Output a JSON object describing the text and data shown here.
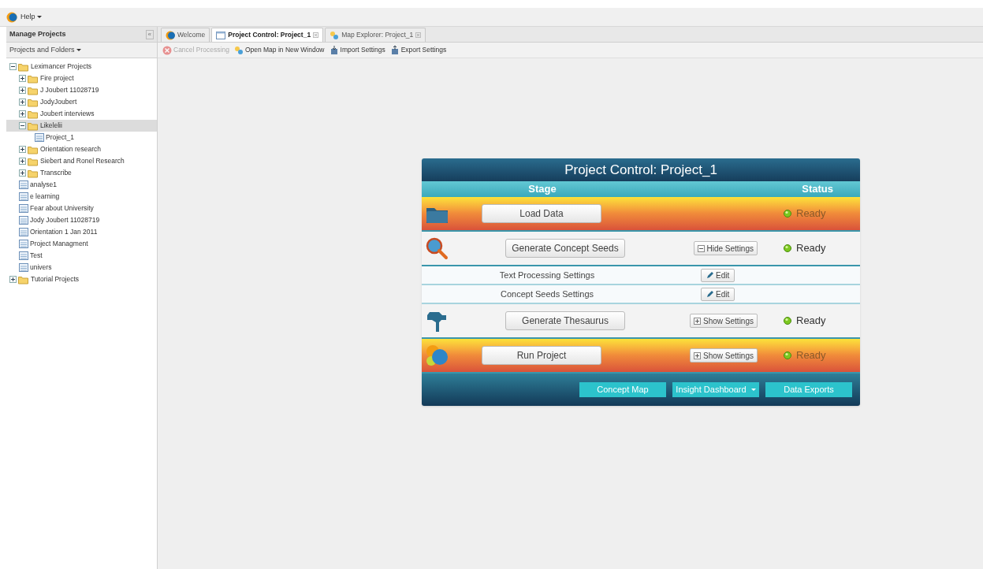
{
  "menu": {
    "label": "Help"
  },
  "sidebar": {
    "title": "Manage Projects",
    "collapse": "«",
    "dropdown": "Projects and Folders",
    "tree": [
      {
        "label": "Leximancer Projects",
        "kind": "folder",
        "expanded": true,
        "selected": false,
        "children": [
          {
            "label": "Fire project",
            "kind": "folder",
            "expanded": false,
            "selected": false
          },
          {
            "label": "J Joubert 11028719",
            "kind": "folder",
            "expanded": false,
            "selected": false
          },
          {
            "label": "JodyJoubert",
            "kind": "folder",
            "expanded": false,
            "selected": false
          },
          {
            "label": "Joubert interviews",
            "kind": "folder",
            "expanded": false,
            "selected": false
          },
          {
            "label": "Likelelii",
            "kind": "folder",
            "expanded": true,
            "selected": true,
            "children": [
              {
                "label": "Project_1",
                "kind": "project",
                "selected": false
              }
            ]
          },
          {
            "label": "Orientation research",
            "kind": "folder",
            "expanded": false,
            "selected": false
          },
          {
            "label": "Siebert and Ronel Research",
            "kind": "folder",
            "expanded": false,
            "selected": false
          },
          {
            "label": "Transcribe",
            "kind": "folder",
            "expanded": false,
            "selected": false
          },
          {
            "label": "analyse1",
            "kind": "project",
            "selected": false
          },
          {
            "label": "e learning",
            "kind": "project",
            "selected": false
          },
          {
            "label": "Fear about University",
            "kind": "project",
            "selected": false
          },
          {
            "label": "Jody Joubert 11028719",
            "kind": "project",
            "selected": false
          },
          {
            "label": "Orientation 1 Jan 2011",
            "kind": "project",
            "selected": false
          },
          {
            "label": "Project Managment",
            "kind": "project",
            "selected": false
          },
          {
            "label": "Test",
            "kind": "project",
            "selected": false
          },
          {
            "label": "univers",
            "kind": "project",
            "selected": false
          }
        ]
      },
      {
        "label": "Tutorial Projects",
        "kind": "folder",
        "expanded": false,
        "selected": false
      }
    ]
  },
  "tabs": [
    {
      "label": "Welcome",
      "closable": false,
      "selected": false
    },
    {
      "label": "Project Control: Project_1",
      "closable": true,
      "selected": true
    },
    {
      "label": "Map Explorer: Project_1",
      "closable": true,
      "selected": false
    }
  ],
  "toolbar": [
    {
      "label": "Cancel Processing",
      "disabled": true
    },
    {
      "label": "Open Map in New Window",
      "disabled": false
    },
    {
      "label": "Import Settings",
      "disabled": false
    },
    {
      "label": "Export Settings",
      "disabled": false
    }
  ],
  "panel": {
    "title": "Project Control: Project_1",
    "col_stage": "Stage",
    "col_status": "Status",
    "stages": [
      {
        "kind": "highlighted",
        "label": "Load Data",
        "status": "Ready"
      },
      {
        "kind": "normal",
        "label": "Generate Concept Seeds",
        "settings": {
          "label": "Hide Settings",
          "expanded": true
        },
        "status": "Ready",
        "sub_settings": [
          {
            "label": "Text Processing Settings",
            "action": "Edit"
          },
          {
            "label": "Concept Seeds Settings",
            "action": "Edit"
          }
        ]
      },
      {
        "kind": "normal",
        "label": "Generate Thesaurus",
        "settings": {
          "label": "Show Settings",
          "expanded": false
        },
        "status": "Ready"
      },
      {
        "kind": "highlighted",
        "label": "Run Project",
        "settings": {
          "label": "Show Settings",
          "expanded": false
        },
        "status": "Ready"
      }
    ],
    "footer": [
      {
        "label": "Concept Map",
        "dropdown": false
      },
      {
        "label": "Insight Dashboard",
        "dropdown": true
      },
      {
        "label": "Data Exports",
        "dropdown": false
      }
    ]
  }
}
